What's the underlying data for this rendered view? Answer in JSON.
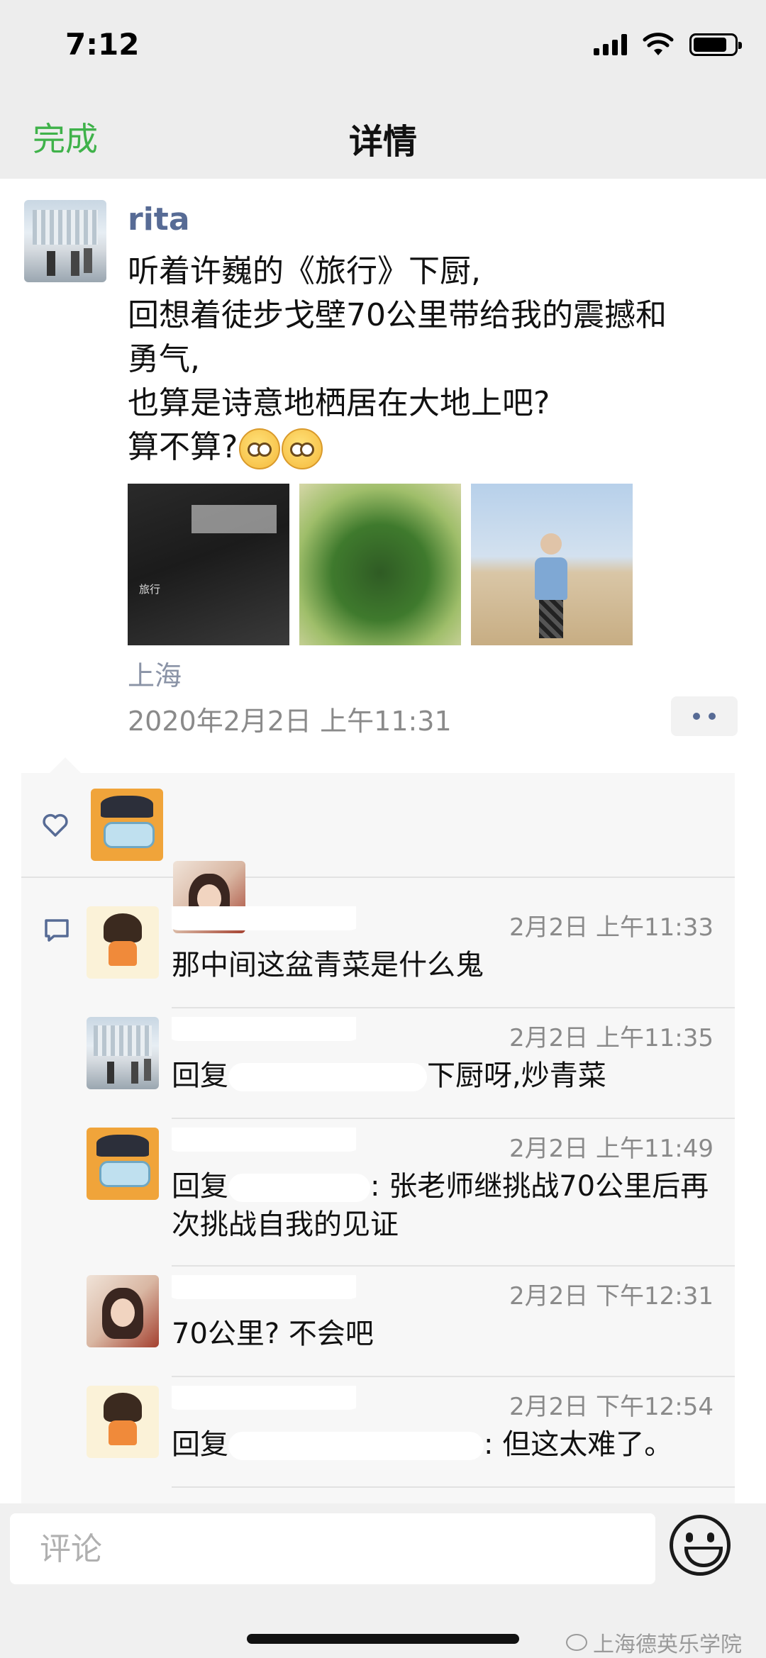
{
  "status_bar": {
    "time": "7:12"
  },
  "nav": {
    "done_label": "完成",
    "title": "详情"
  },
  "post": {
    "author": "rita",
    "lines": [
      "听着许巍的《旅行》下厨,",
      "回想着徒步戈壁70公里带给我的震撼和",
      "勇气,",
      "也算是诗意地栖居在大地上吧?",
      "算不算?"
    ],
    "emojis": [
      "smirk-emoji",
      "smirk-emoji"
    ],
    "photos": [
      {
        "name": "music-screenshot-photo",
        "song_title": "旅行"
      },
      {
        "name": "greens-photo"
      },
      {
        "name": "desert-hiker-photo"
      }
    ],
    "location": "上海",
    "timestamp": "2020年2月2日 上午11:31"
  },
  "likes": {
    "icon": "heart-icon"
  },
  "comments": [
    {
      "time": "2月2日 上午11:33",
      "text": "那中间这盆青菜是什么鬼"
    },
    {
      "time": "2月2日 上午11:35",
      "prefix": "回复",
      "text": "下厨呀,炒青菜"
    },
    {
      "time": "2月2日 上午11:49",
      "prefix": "回复",
      "text": ": 张老师继挑战70公里后再次挑战自我的见证"
    },
    {
      "time": "2月2日 下午12:31",
      "text": "70公里? 不会吧"
    },
    {
      "time": "2月2日 下午12:54",
      "prefix": "回复",
      "text": ": 但这太难了。"
    }
  ],
  "input": {
    "placeholder": "评论"
  },
  "watermark": "上海德英乐学院"
}
